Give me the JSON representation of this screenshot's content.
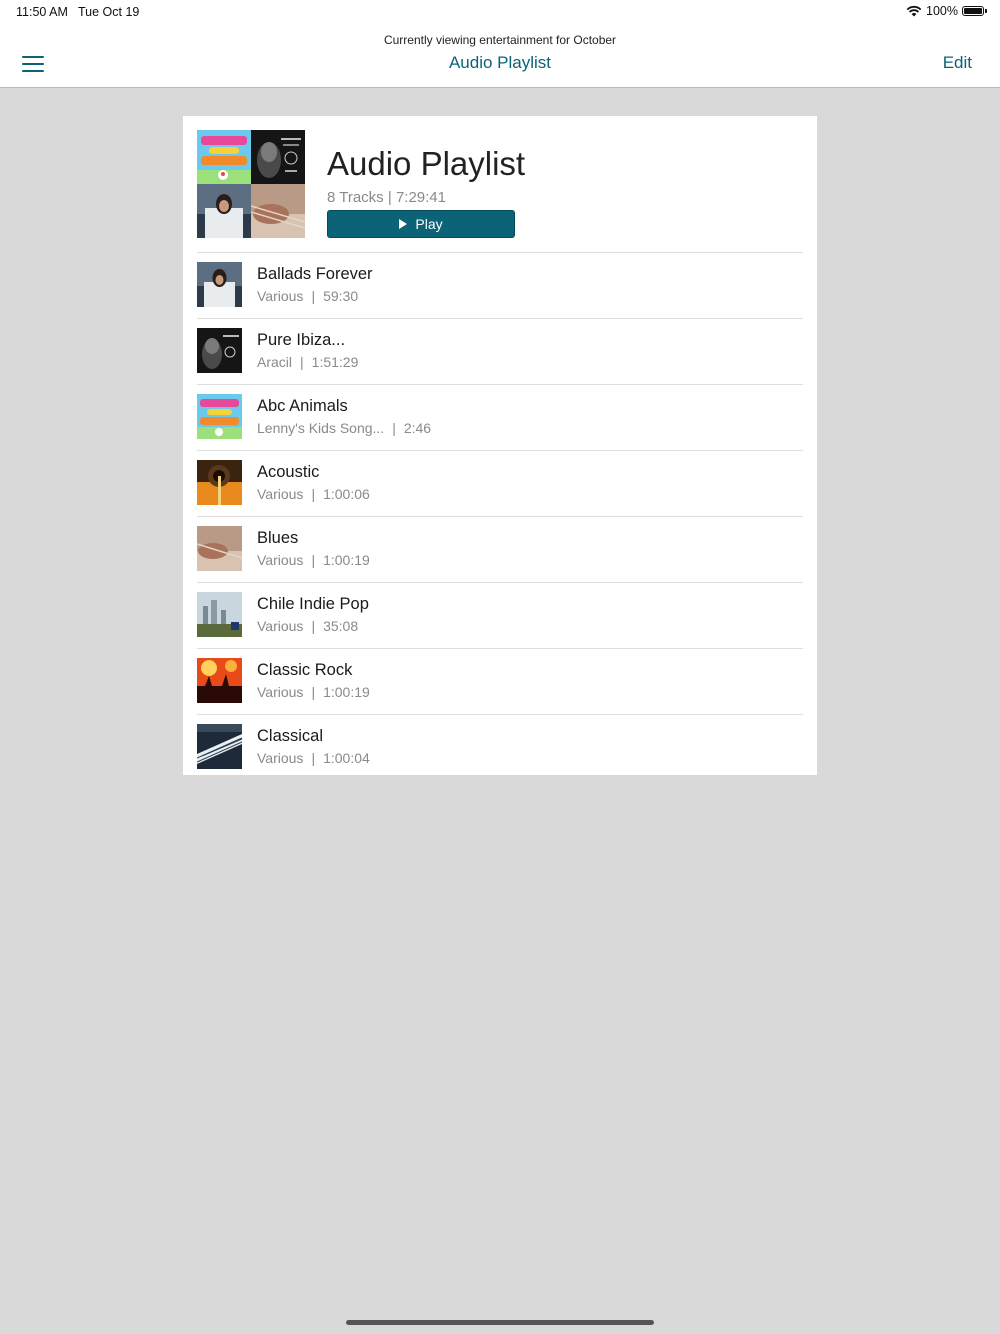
{
  "status": {
    "time": "11:50 AM",
    "date": "Tue Oct 19",
    "battery": "100%",
    "battery_level": 1.0
  },
  "nav": {
    "subtitle": "Currently viewing entertainment for October",
    "title": "Audio Playlist",
    "edit_label": "Edit",
    "menu_icon": "hamburger-menu-icon"
  },
  "playlist": {
    "title": "Audio Playlist",
    "tracks_count": "8 Tracks",
    "duration": "7:29:41",
    "play_label": "Play"
  },
  "tracks": [
    {
      "title": "Ballads Forever",
      "artist": "Various",
      "duration": "59:30",
      "art": "ballads"
    },
    {
      "title": "Pure Ibiza...",
      "artist": "Aracil",
      "duration": "1:51:29",
      "art": "ibiza"
    },
    {
      "title": "Abc Animals",
      "artist": "Lenny's Kids Song...",
      "duration": "2:46",
      "art": "animals"
    },
    {
      "title": "Acoustic",
      "artist": "Various",
      "duration": "1:00:06",
      "art": "acoustic"
    },
    {
      "title": "Blues",
      "artist": "Various",
      "duration": "1:00:19",
      "art": "blues"
    },
    {
      "title": "Chile Indie Pop",
      "artist": "Various",
      "duration": "35:08",
      "art": "chile"
    },
    {
      "title": "Classic Rock",
      "artist": "Various",
      "duration": "1:00:19",
      "art": "rock"
    },
    {
      "title": "Classical",
      "artist": "Various",
      "duration": "1:00:04",
      "art": "classical"
    }
  ],
  "colors": {
    "accent": "#0c6378",
    "background": "#d9d9d9",
    "meta_text": "#8a8a8a"
  }
}
